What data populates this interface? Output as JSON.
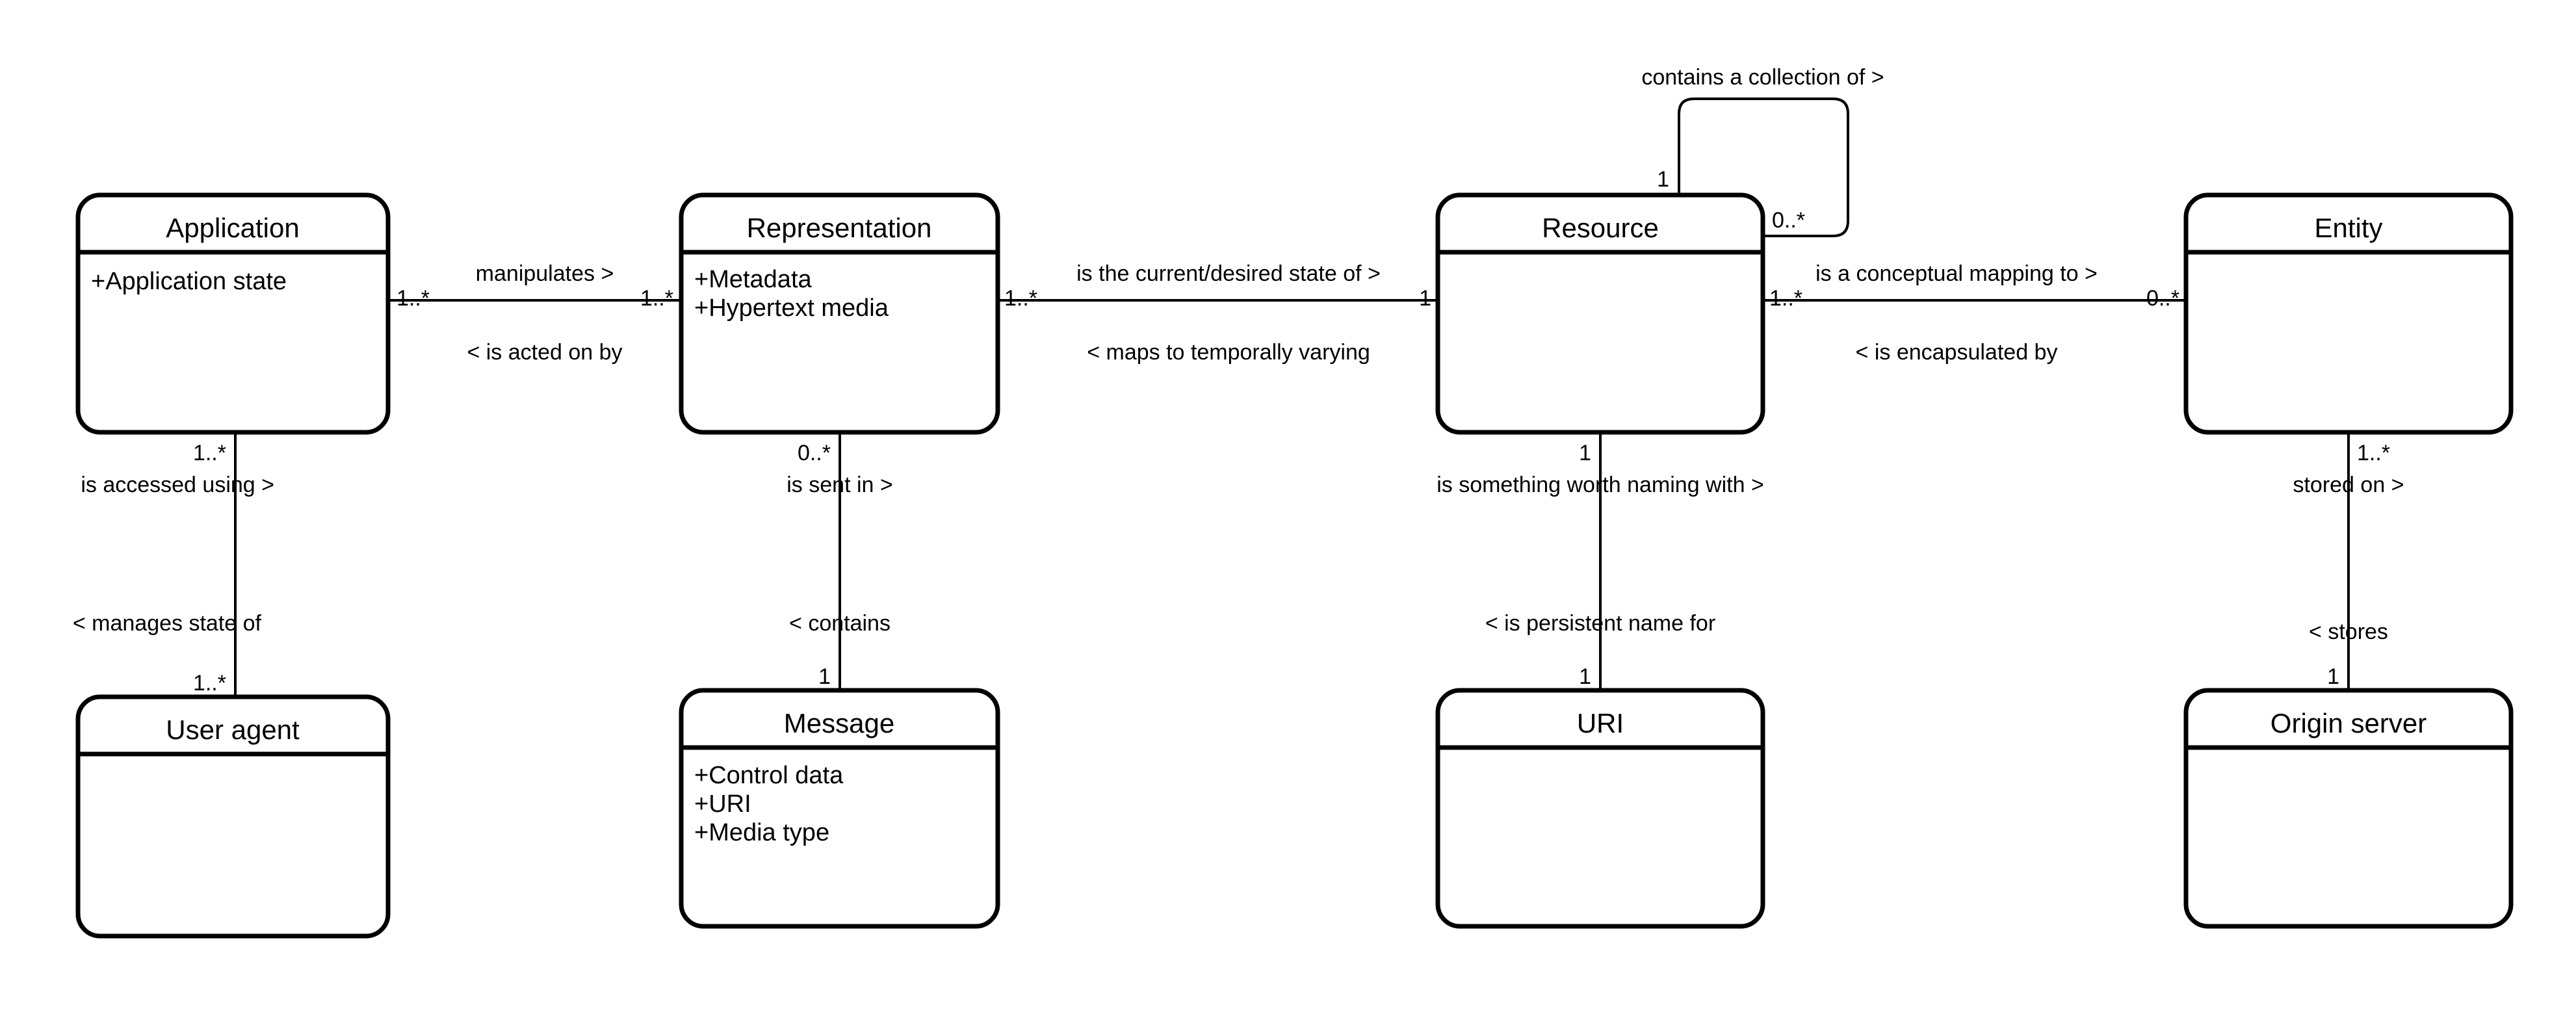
{
  "diagram": {
    "kind": "uml-class-diagram",
    "stroke_color": "#000000",
    "background_color": "#ffffff",
    "classes": [
      {
        "id": "application",
        "name": "Application",
        "attributes": [
          "+Application state"
        ]
      },
      {
        "id": "representation",
        "name": "Representation",
        "attributes": [
          "+Metadata",
          "+Hypertext media"
        ]
      },
      {
        "id": "resource",
        "name": "Resource",
        "attributes": []
      },
      {
        "id": "entity",
        "name": "Entity",
        "attributes": []
      },
      {
        "id": "useragent",
        "name": "User agent",
        "attributes": []
      },
      {
        "id": "message",
        "name": "Message",
        "attributes": [
          "+Control data",
          "+URI",
          "+Media type"
        ]
      },
      {
        "id": "uri",
        "name": "URI",
        "attributes": []
      },
      {
        "id": "originserver",
        "name": "Origin server",
        "attributes": []
      }
    ],
    "associations": [
      {
        "id": "app-representation",
        "from": "application",
        "to": "representation",
        "forward_label": "manipulates >",
        "reverse_label": "< is acted on by",
        "from_multiplicity": "1..*",
        "to_multiplicity": "1..*"
      },
      {
        "id": "representation-resource",
        "from": "representation",
        "to": "resource",
        "forward_label": "is the current/desired state of >",
        "reverse_label": "< maps to temporally varying",
        "from_multiplicity": "1..*",
        "to_multiplicity": "1"
      },
      {
        "id": "resource-entity",
        "from": "resource",
        "to": "entity",
        "forward_label": "is a conceptual mapping to >",
        "reverse_label": "< is encapsulated by",
        "from_multiplicity": "1..*",
        "to_multiplicity": "0..*"
      },
      {
        "id": "resource-self",
        "from": "resource",
        "to": "resource",
        "forward_label": "contains a collection of >",
        "reverse_label": "",
        "from_multiplicity": "1",
        "to_multiplicity": "0..*"
      },
      {
        "id": "app-useragent",
        "from": "application",
        "to": "useragent",
        "forward_label": "is accessed using  >",
        "reverse_label": "< manages state of",
        "from_multiplicity": "1..*",
        "to_multiplicity": "1..*"
      },
      {
        "id": "representation-message",
        "from": "representation",
        "to": "message",
        "forward_label": "is sent in >",
        "reverse_label": "< contains",
        "from_multiplicity": "0..*",
        "to_multiplicity": "1"
      },
      {
        "id": "resource-uri",
        "from": "resource",
        "to": "uri",
        "forward_label": "is something worth naming with >",
        "reverse_label": "< is persistent name for",
        "from_multiplicity": "1",
        "to_multiplicity": "1"
      },
      {
        "id": "entity-originserver",
        "from": "entity",
        "to": "originserver",
        "forward_label": "stored on >",
        "reverse_label": "< stores",
        "from_multiplicity": "1..*",
        "to_multiplicity": "1"
      }
    ]
  }
}
